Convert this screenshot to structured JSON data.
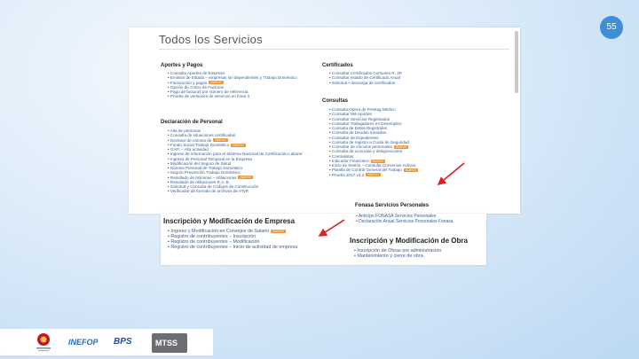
{
  "slide_number": "55",
  "page": {
    "title": "Todos los Servicios",
    "sections": {
      "aportes": {
        "heading": "Aportes y Pagos",
        "items": [
          {
            "label": "Consulta Aportes de Empresa"
          },
          {
            "label": "Emisión de Estado – empresas sin dependientes y Trabajo Doméstico"
          },
          {
            "label": "Facturación y pagos",
            "badge": "NUEVO"
          },
          {
            "label": "Opción de Cobro de Facturas"
          },
          {
            "label": "Pago de facturas por número de referencia"
          },
          {
            "label": "Prueba de versiones de servicios en línea 3"
          }
        ]
      },
      "declaracion": {
        "heading": "Declaración de Personal",
        "items": [
          {
            "label": "Alta de personas"
          },
          {
            "label": "Consulta de situaciones certificadas"
          },
          {
            "label": "Declarar de nómina de",
            "badge": "NUEVO"
          },
          {
            "label": "Fondo Social Trabajo Doméstico",
            "badge": "NUEVO"
          },
          {
            "label": "GAFI – Alta actividad"
          },
          {
            "label": "Ingreso de información para el Sistema Nacional de Certificación Laboral"
          },
          {
            "label": "Ingreso de Personal Temporal en la Empresa"
          },
          {
            "label": "Modificación del Seguro de Salud"
          },
          {
            "label": "Nómina Personal de Trabajo Doméstico"
          },
          {
            "label": "Seguro Prevención Trabajo Doméstico"
          },
          {
            "label": "Resultado de Nóminas – Afiliaciones",
            "badge": "NUEVO"
          },
          {
            "label": "Resultado de Afiliaciones R.A. B"
          },
          {
            "label": "Solicitud y Consulta de Códigos de Construcción"
          },
          {
            "label": "Verificador de formato de archivos de ATyR"
          }
        ]
      },
      "certificados": {
        "heading": "Certificados",
        "items": [
          {
            "label": "Consultar Certificados Comunes R. JR"
          },
          {
            "label": "Consultar estado de Certificado Anual"
          },
          {
            "label": "Solicitud • descarga de certificados"
          }
        ]
      },
      "consultas": {
        "heading": "Consultas",
        "items": [
          {
            "label": "Consulta Opera de Prestag Médico"
          },
          {
            "label": "Consultar Mis Aportes"
          },
          {
            "label": "Consultar Servicios Registrados"
          },
          {
            "label": "Consultar Trabajadores en Desempleo"
          },
          {
            "label": "Consulta de Datos Registrales"
          },
          {
            "label": "Consulta de Deudas Iniciadas"
          },
          {
            "label": "Consultar de Expedientes"
          },
          {
            "label": "Consulta de registro a Cuota de Seguridad"
          },
          {
            "label": "Consultar de vínculos personales",
            "badge": "NUEVO"
          },
          {
            "label": "Consulta de Licencias y designaciones"
          },
          {
            "label": "Contratistas"
          },
          {
            "label": "Indicador Financiero",
            "badge": "NUEVO"
          },
          {
            "label": "Inicio de Sesión – Consulta Convenios Activos"
          },
          {
            "label": "Planilla de Control General del Trabajo",
            "badge": "NUEVO"
          },
          {
            "label": "Prueba 2017 v4.2",
            "badge": "NUEVO"
          }
        ]
      },
      "fonasa": {
        "heading": "Fonasa Servicios Personales",
        "items": [
          {
            "label": "Anticipo FONASA Servicios Personales"
          },
          {
            "label": "Declaración Anual Servicios Personales Fonasa"
          }
        ]
      },
      "inscripcion_empresa": {
        "heading": "Inscripción y Modificación de Empresa",
        "items": [
          {
            "label": "Ingreso y Modificación en Consejos de Salario",
            "badge": "NUEVO"
          },
          {
            "label": "Registro de contribuyentes – Inscripción"
          },
          {
            "label": "Registro de contribuyentes – Modificación"
          },
          {
            "label": "Registro de contribuyentes – Inicio de actividad de empresa"
          }
        ]
      },
      "inscripcion_obra": {
        "heading": "Inscripción y Modificación de Obra",
        "items": [
          {
            "label": "Inscripción de Obras por administración"
          },
          {
            "label": "Mantenimiento y cierre de obra"
          }
        ]
      }
    }
  },
  "footer": {
    "logos": [
      "INEFOP",
      "BPS",
      "MTSS"
    ]
  },
  "colors": {
    "badge": "#f0932b",
    "link": "#3a5d99",
    "arrow": "#e02020",
    "accent": "#3f8fd6"
  }
}
